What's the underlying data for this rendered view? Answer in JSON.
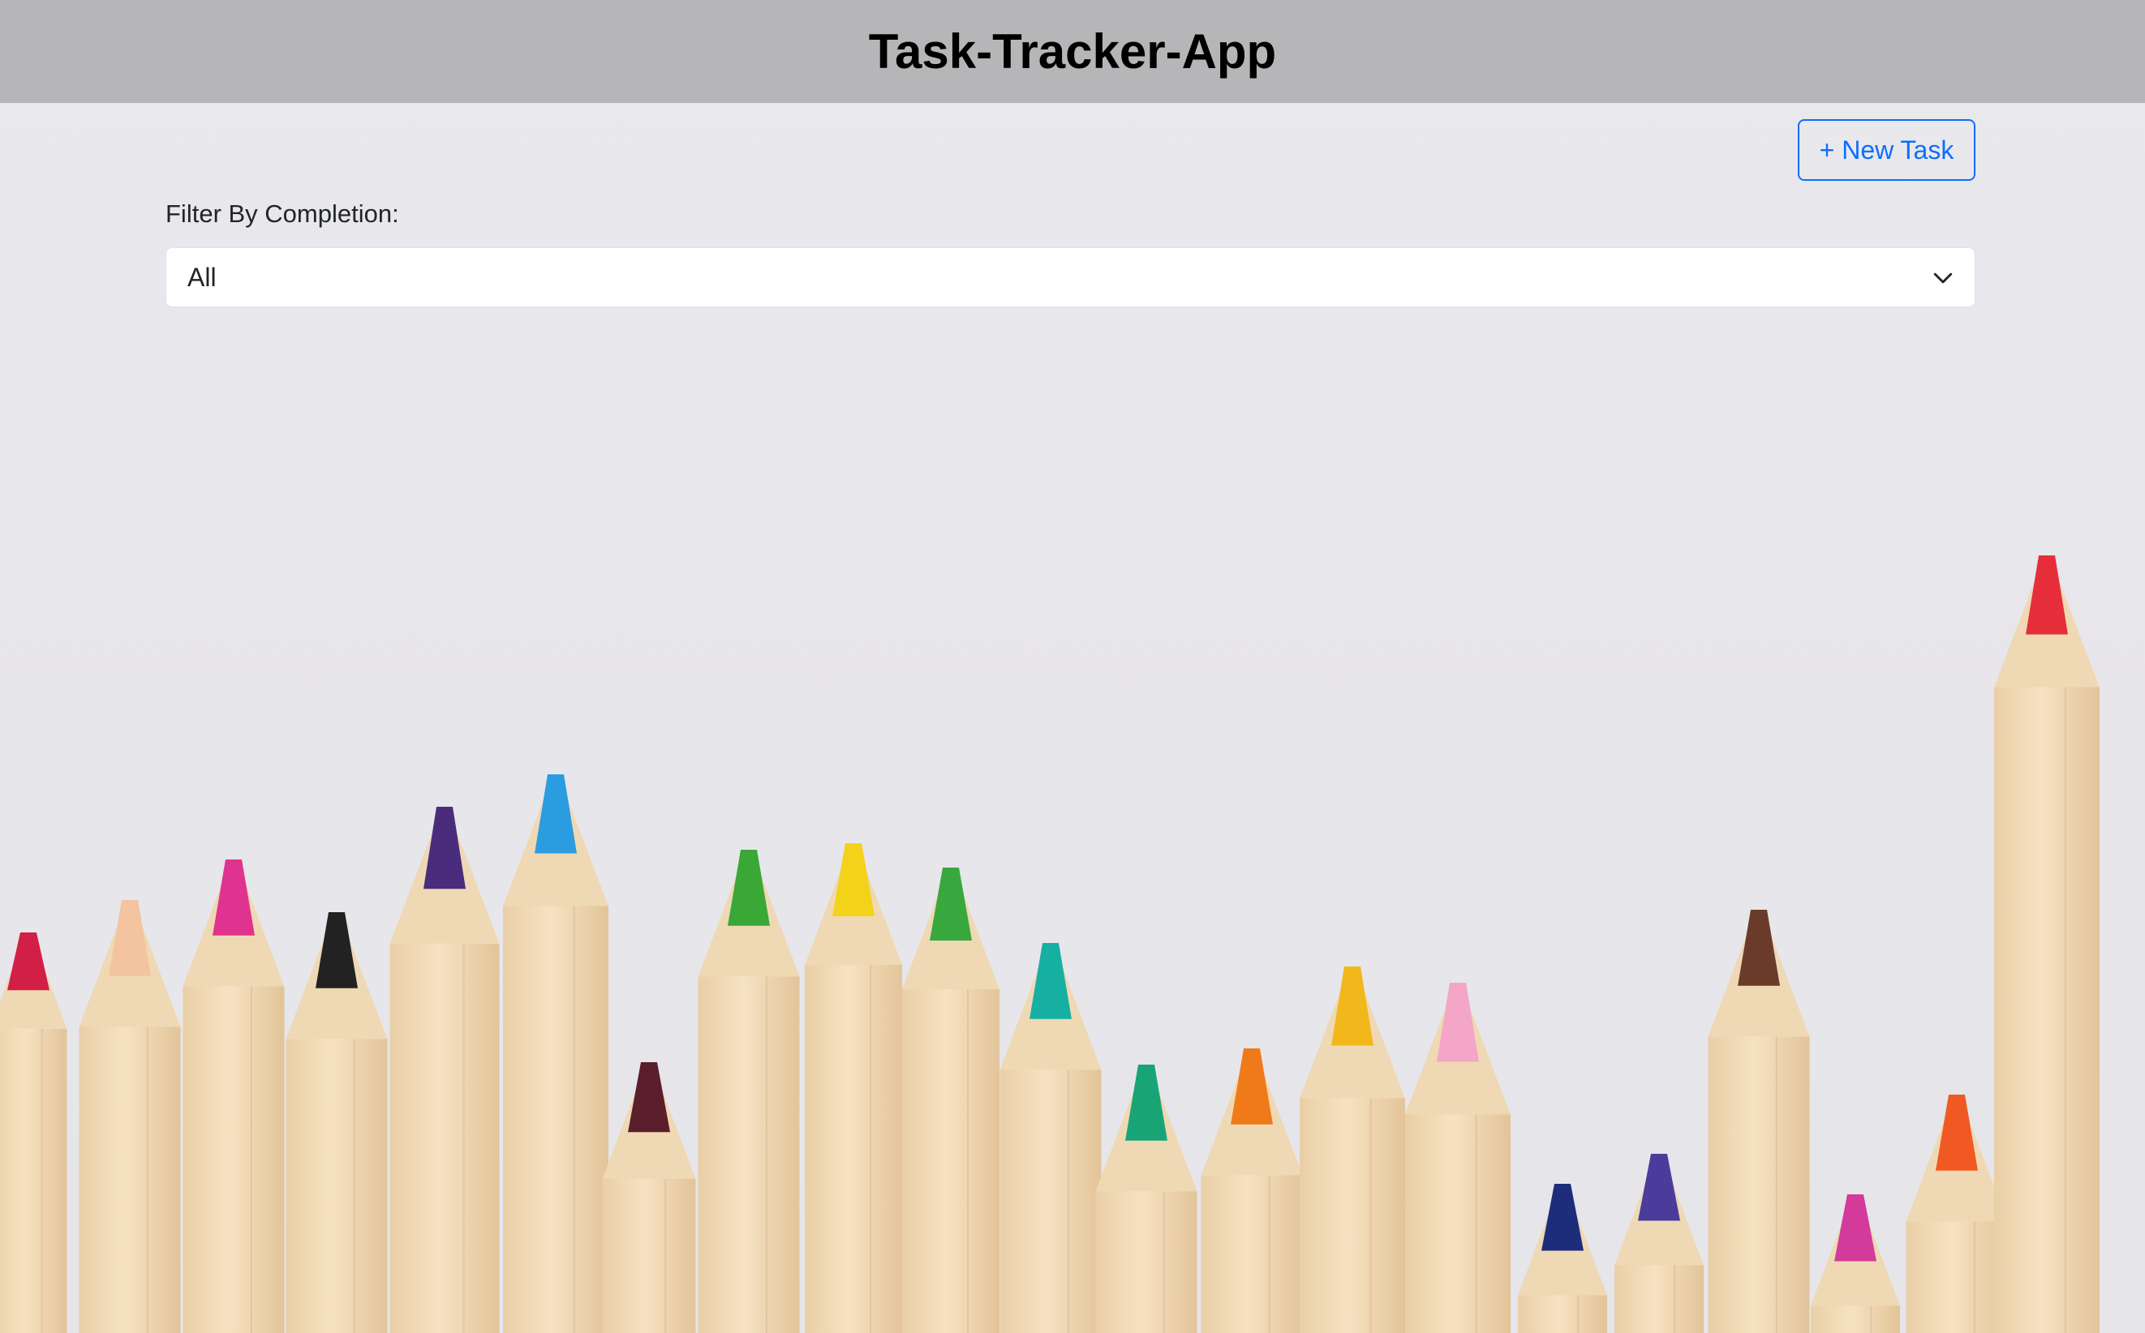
{
  "app": {
    "title": "Task-Tracker-App"
  },
  "toolbar": {
    "new_task_label": "+ New Task"
  },
  "filter": {
    "label": "Filter By Completion:",
    "selected": "All"
  },
  "colors": {
    "header_bg": "#b6b6b8",
    "accent": "#0d6efd",
    "page_bg": "#e8e8eb"
  },
  "icons": {
    "select_chevron": "chevron-down-icon"
  }
}
